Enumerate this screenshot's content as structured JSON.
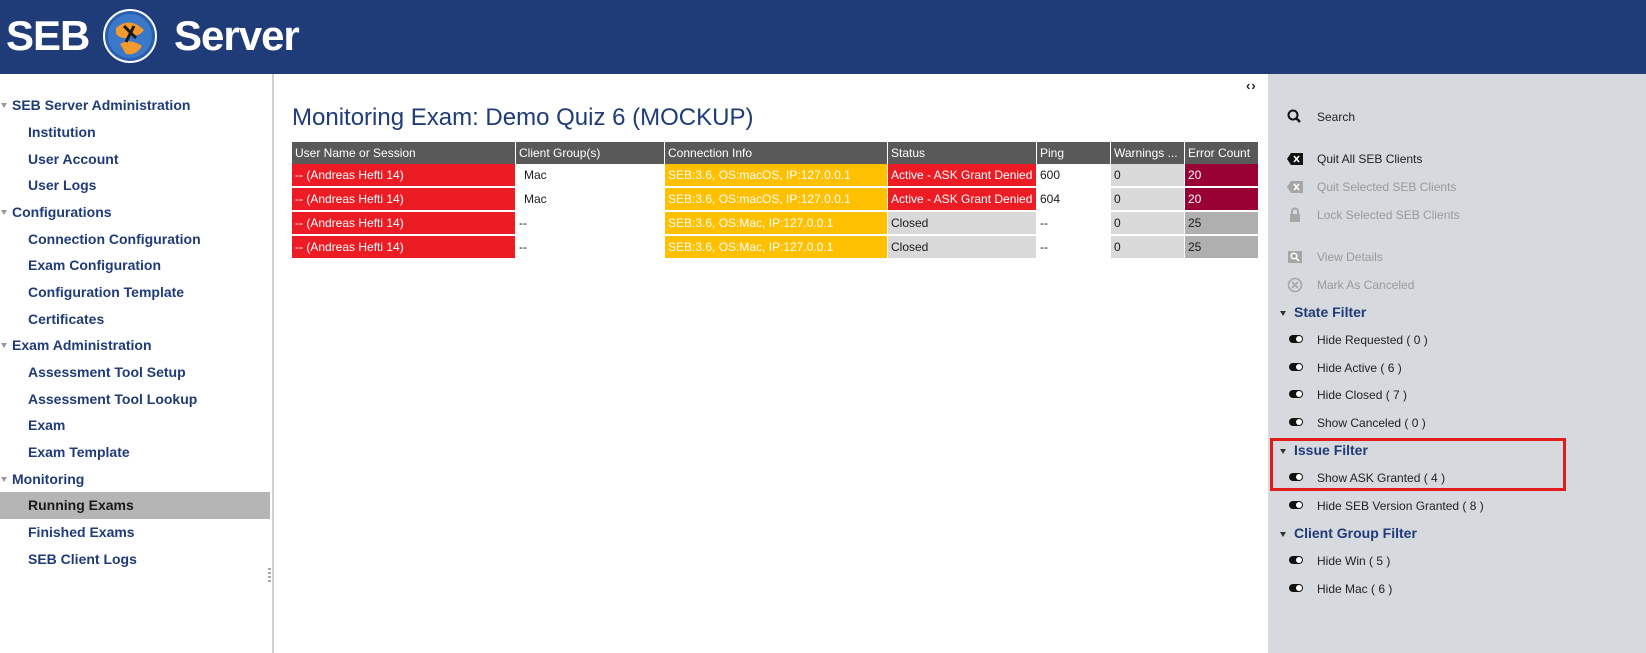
{
  "header": {
    "logo_left": "SEB",
    "logo_right": "Server"
  },
  "nav": [
    {
      "label": "SEB Server Administration",
      "type": "cat"
    },
    {
      "label": "Institution",
      "type": "sub"
    },
    {
      "label": "User Account",
      "type": "sub"
    },
    {
      "label": "User Logs",
      "type": "sub"
    },
    {
      "label": "Configurations",
      "type": "cat"
    },
    {
      "label": "Connection Configuration",
      "type": "sub"
    },
    {
      "label": "Exam Configuration",
      "type": "sub"
    },
    {
      "label": "Configuration Template",
      "type": "sub"
    },
    {
      "label": "Certificates",
      "type": "sub"
    },
    {
      "label": "Exam Administration",
      "type": "cat"
    },
    {
      "label": "Assessment Tool Setup",
      "type": "sub"
    },
    {
      "label": "Assessment Tool Lookup",
      "type": "sub"
    },
    {
      "label": "Exam",
      "type": "sub"
    },
    {
      "label": "Exam Template",
      "type": "sub"
    },
    {
      "label": "Monitoring",
      "type": "cat"
    },
    {
      "label": "Running Exams",
      "type": "sub",
      "active": true
    },
    {
      "label": "Finished Exams",
      "type": "sub"
    },
    {
      "label": "SEB Client Logs",
      "type": "sub"
    }
  ],
  "main": {
    "collapse_arrows": "‹›",
    "title": "Monitoring Exam: Demo Quiz 6 (MOCKUP)",
    "columns": [
      "User Name or Session",
      "Client Group(s)",
      "Connection Info",
      "Status",
      "Ping",
      "Warnings ...",
      "Error Count"
    ],
    "rows": [
      {
        "user": "-- (Andreas Hefti 14)",
        "group": "Mac",
        "conn": "SEB:3.6, OS:macOS, IP:127.0.0.1",
        "status": "Active - ASK Grant Denied",
        "ping": "600",
        "warnings": "0",
        "errors": "20"
      },
      {
        "user": "-- (Andreas Hefti 14)",
        "group": "Mac",
        "conn": "SEB:3.6, OS:macOS, IP:127.0.0.1",
        "status": "Active - ASK Grant Denied",
        "ping": "604",
        "warnings": "0",
        "errors": "20"
      },
      {
        "user": "-- (Andreas Hefti 14)",
        "group": "--",
        "conn": "SEB:3.6, OS:Mac, IP:127.0.0.1",
        "status": "Closed",
        "ping": "--",
        "warnings": "0",
        "errors": "25"
      },
      {
        "user": "-- (Andreas Hefti 14)",
        "group": "--",
        "conn": "SEB:3.6, OS:Mac, IP:127.0.0.1",
        "status": "Closed",
        "ping": "--",
        "warnings": "0",
        "errors": "25"
      }
    ]
  },
  "pane": {
    "search": "Search",
    "actions": [
      {
        "label": "Quit All SEB Clients",
        "icon": "quit-icon",
        "enabled": true
      },
      {
        "label": "Quit Selected SEB Clients",
        "icon": "quit-icon",
        "enabled": false
      },
      {
        "label": "Lock Selected SEB Clients",
        "icon": "lock-icon",
        "enabled": false
      },
      {
        "label": "View Details",
        "icon": "view-details-icon",
        "enabled": false
      },
      {
        "label": "Mark As Canceled",
        "icon": "cancel-icon",
        "enabled": false
      }
    ],
    "state_filter": {
      "title": "State Filter",
      "items": [
        "Hide Requested ( 0 )",
        "Hide Active ( 6 )",
        "Hide Closed ( 7 )",
        "Show Canceled ( 0 )"
      ]
    },
    "issue_filter": {
      "title": "Issue Filter",
      "items": [
        "Show ASK Granted ( 4 )",
        "Hide SEB Version Granted ( 8 )"
      ]
    },
    "client_group_filter": {
      "title": "Client Group Filter",
      "items": [
        "Hide Win ( 5 )",
        "Hide Mac ( 6 )"
      ]
    },
    "highlight_color": "#e21b1b"
  }
}
